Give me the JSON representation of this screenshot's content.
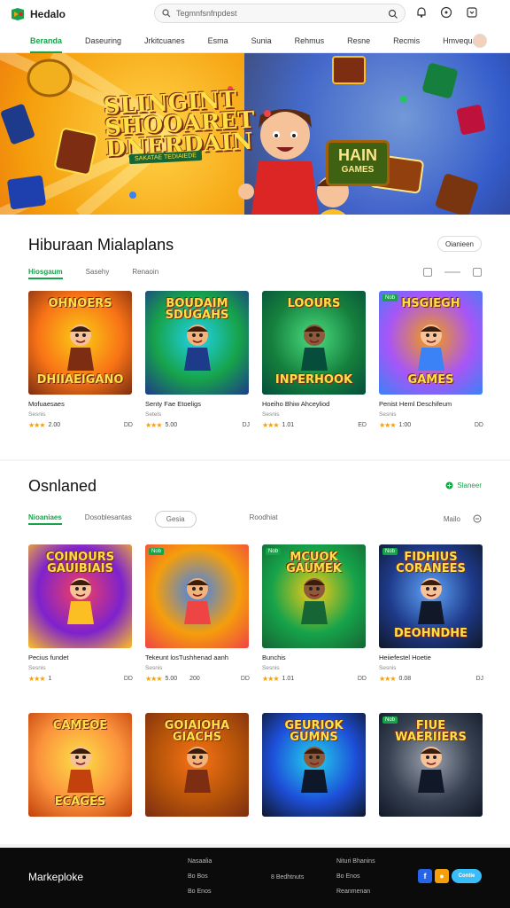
{
  "header": {
    "logo_text": "Hedalo",
    "search_placeholder": "Tegmnfsnfnpdest",
    "icons": [
      "search-icon",
      "camera-icon",
      "bell-icon",
      "help-icon",
      "cart-icon"
    ]
  },
  "nav": {
    "items": [
      {
        "label": "Beranda",
        "active": true
      },
      {
        "label": "Daseuring",
        "active": false
      },
      {
        "label": "Jrkitcuanes",
        "active": false
      },
      {
        "label": "Esma",
        "active": false
      },
      {
        "label": "Sunia",
        "active": false
      },
      {
        "label": "Rehmus",
        "active": false
      },
      {
        "label": "Resne",
        "active": false
      },
      {
        "label": "Recmis",
        "active": false
      },
      {
        "label": "Hmvequnes",
        "active": false
      }
    ]
  },
  "hero": {
    "title_line1": "SLINGINT",
    "title_line2": "SHOOARET",
    "title_line3": "DNERDAIN",
    "subtitle": "SAKATAE TEDIAIEDE",
    "badge_line1": "HAIN",
    "badge_line2": "GAMES"
  },
  "section1": {
    "title": "Hiburaan Mialaplans",
    "button": "Oianieen",
    "tabs": [
      "Hiosgaum",
      "Sasehy",
      "Renaoin"
    ],
    "cards": [
      {
        "top": "OHNOERS",
        "bottom": "DHIIAEIGANO",
        "name": "Mofuaesaes",
        "sub": "Sesnis",
        "rating": "2.00",
        "end": "DD"
      },
      {
        "top": "BOUDAIM SDUGAHS",
        "bottom": "",
        "name": "Senty Fae Etoeligs",
        "sub": "Setels",
        "rating": "5.00",
        "end": "DJ"
      },
      {
        "top": "LOOURS",
        "bottom": "INPERHOOK",
        "name": "Hoeiho Bhiw Ahceyliod",
        "sub": "Sesnis",
        "rating": "1.01",
        "end": "ED"
      },
      {
        "top": "HSGIEGH",
        "bottom": "GAMES",
        "tag": "Nob",
        "name": "Penist Heml Deschifeum",
        "sub": "Sesnis",
        "rating": "1:00",
        "end": "DD"
      }
    ]
  },
  "section2": {
    "title": "Osnlaned",
    "link": "Slaneer",
    "tabs": [
      "Nioaniaes",
      "Dosoblesantas",
      "Gesia",
      "Roodhiat"
    ],
    "tools": [
      "Mailo"
    ],
    "cards": [
      {
        "top": "COINOURS GAUIBIAIS",
        "bottom": "",
        "name": "Pecius fundet",
        "sub": "Sesnis",
        "rating": "1",
        "mid": "",
        "end": "DD"
      },
      {
        "top": "",
        "bottom": "",
        "tag": "Nob",
        "name": "Tekeunt losTushhenad aanh",
        "sub": "Sesnis",
        "rating": "5.00",
        "mid": "200",
        "end": "DD"
      },
      {
        "top": "MCUOK GAUMEK",
        "bottom": "",
        "tag": "Nob",
        "name": "Bunchis",
        "sub": "Sesnis",
        "rating": "1.01",
        "mid": "",
        "end": "DD"
      },
      {
        "top": "FIDHIUS CORANEES",
        "bottom": "DEOHNDHE",
        "tag": "Nob",
        "name": "Heiiefestel Hoetie",
        "sub": "Sesnis",
        "rating": "0.08",
        "mid": "",
        "end": "DJ"
      },
      {
        "top": "CAMEOE",
        "bottom": "ECAGES",
        "name": "",
        "sub": "",
        "rating": "",
        "mid": "",
        "end": ""
      },
      {
        "top": "GOIAIOHA GIACHS",
        "bottom": "",
        "name": "",
        "sub": "",
        "rating": "",
        "mid": "",
        "end": ""
      },
      {
        "top": "GEURIOK GUMNS",
        "bottom": "",
        "name": "",
        "sub": "",
        "rating": "",
        "mid": "",
        "end": ""
      },
      {
        "top": "FIUE WAERIIERS",
        "bottom": "",
        "tag": "Nob",
        "name": "",
        "sub": "",
        "rating": "",
        "mid": "",
        "end": ""
      }
    ]
  },
  "footer": {
    "brand": "Markeploke",
    "col1": [
      "Nasaalia",
      "Bo Bos",
      "Bo Enos"
    ],
    "col2": [
      "8 Bedhtnuts"
    ],
    "col3": [
      "Nituri Bhanins",
      "Bo Enos",
      "Reanmenan"
    ],
    "social": [
      "f",
      "●",
      "Contie"
    ]
  },
  "colors": {
    "accent": "#16a34a",
    "star": "#f59e0b",
    "footer_bg": "#0b0b0b"
  }
}
